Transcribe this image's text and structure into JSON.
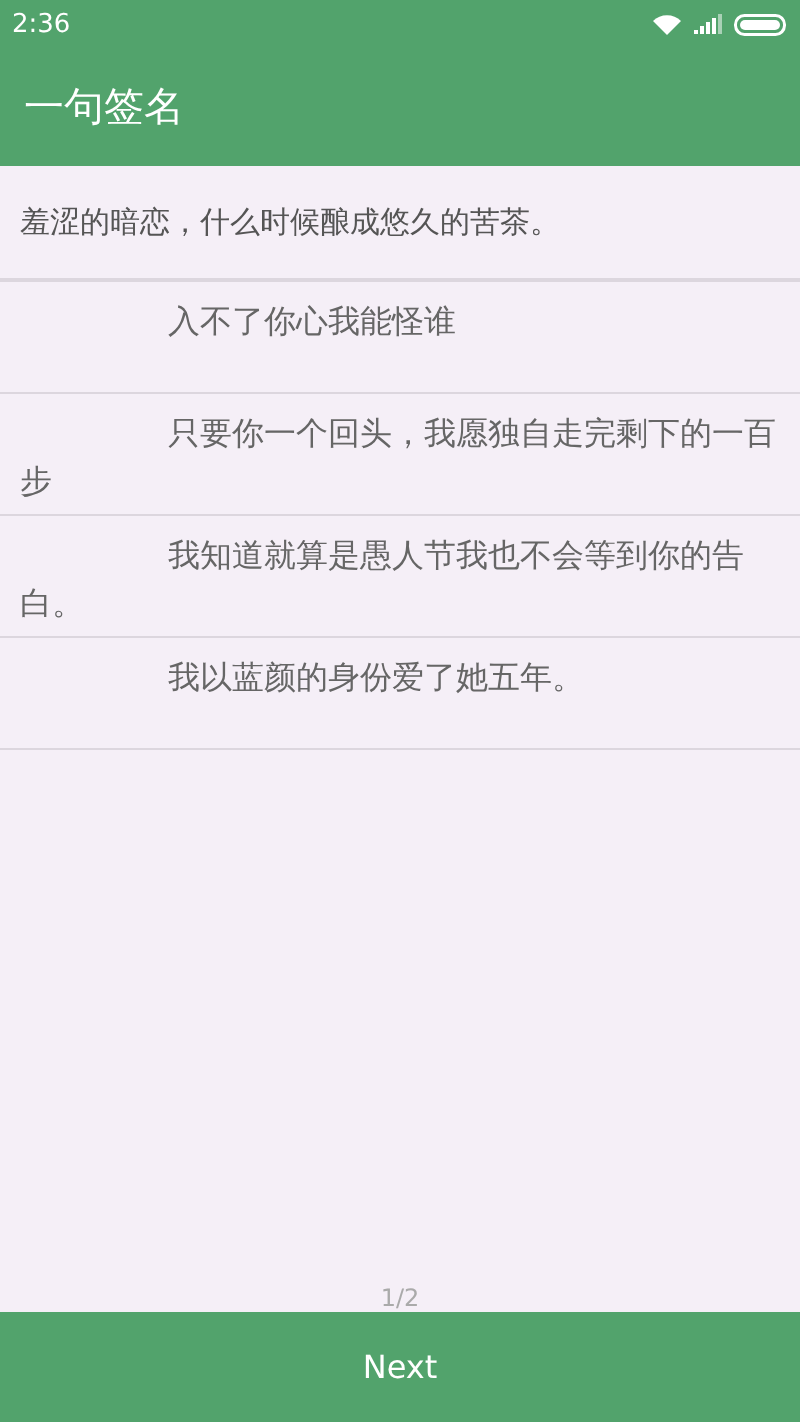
{
  "status_bar": {
    "time": "2:36"
  },
  "app_bar": {
    "title": "一句签名"
  },
  "header": {
    "text": "羞涩的暗恋，什么时候酿成悠久的苦茶。"
  },
  "items": [
    {
      "text": "入不了你心我能怪谁"
    },
    {
      "text": "只要你一个回头，我愿独自走完剩下的一百步"
    },
    {
      "text": "我知道就算是愚人节我也不会等到你的告白。"
    },
    {
      "text": "我以蓝颜的身份爱了她五年。"
    }
  ],
  "pager": {
    "indicator": "1/2",
    "next": "Next"
  }
}
